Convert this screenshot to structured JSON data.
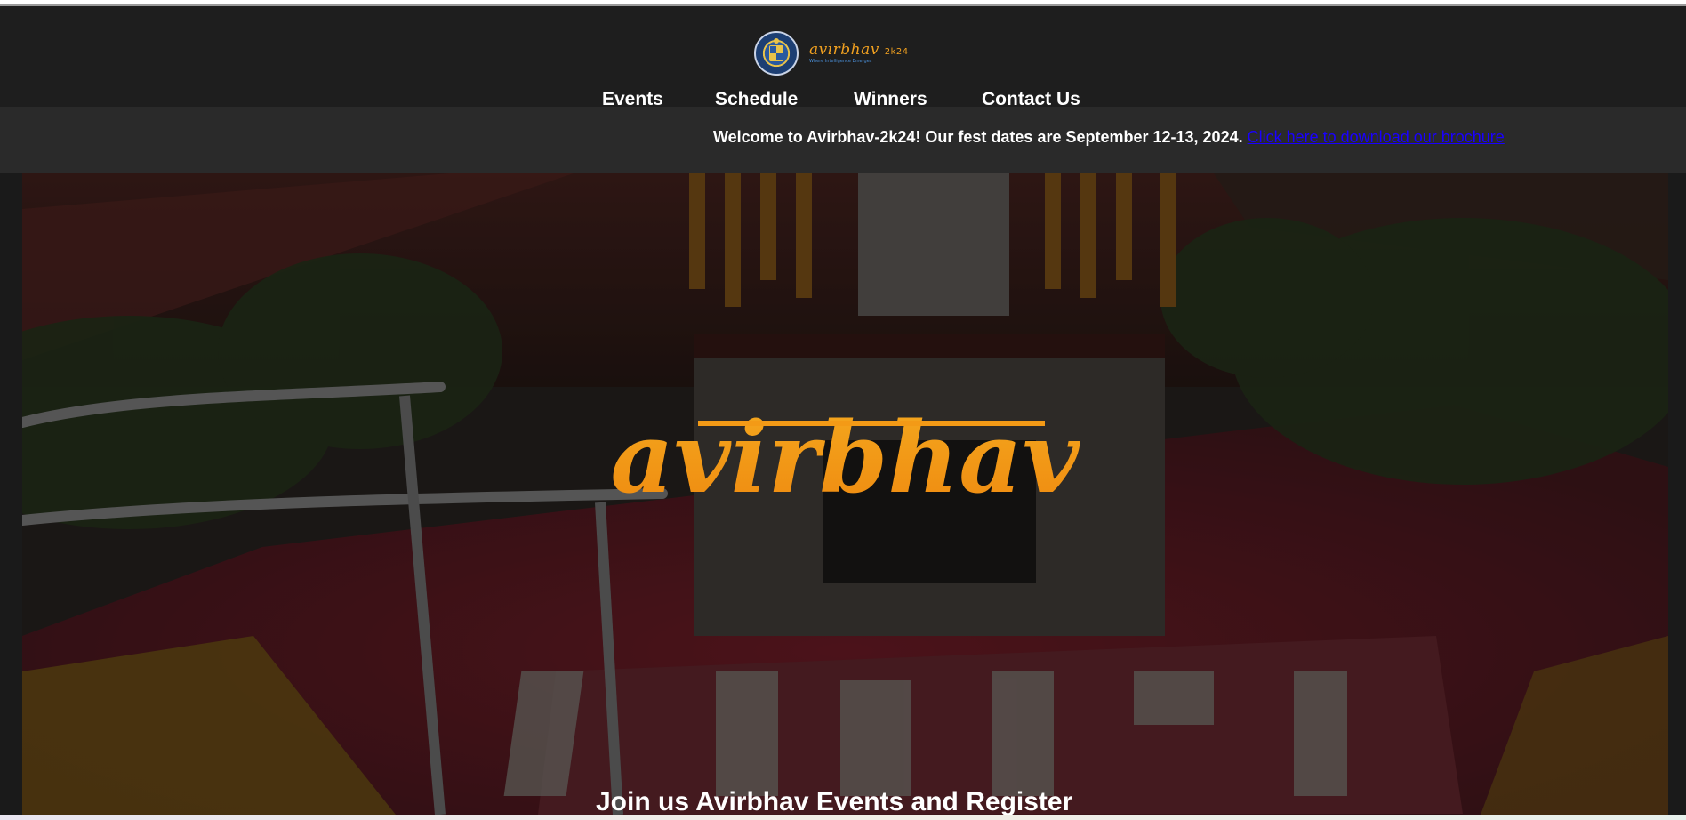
{
  "header": {
    "logo_icon": "college-seal-icon",
    "wordmark": "avirbhav",
    "wordmark_suffix": "2k24",
    "tagline": "Where Intelligence Emerges",
    "nav": [
      {
        "label": "Events"
      },
      {
        "label": "Schedule"
      },
      {
        "label": "Winners"
      },
      {
        "label": "Contact Us"
      }
    ]
  },
  "banner": {
    "message": "Welcome to Avirbhav-2k24! Our fest dates are September 12-13, 2024.",
    "link": "Click here to download our brochure"
  },
  "hero": {
    "logo_text": "avirbhav",
    "headline": "Join us Avirbhav Events and Register"
  },
  "colors": {
    "header_bg": "#1e1e1e",
    "banner_bg": "#2a2a2a",
    "link": "#1a00ff",
    "brand_orange": "#f39a16"
  }
}
